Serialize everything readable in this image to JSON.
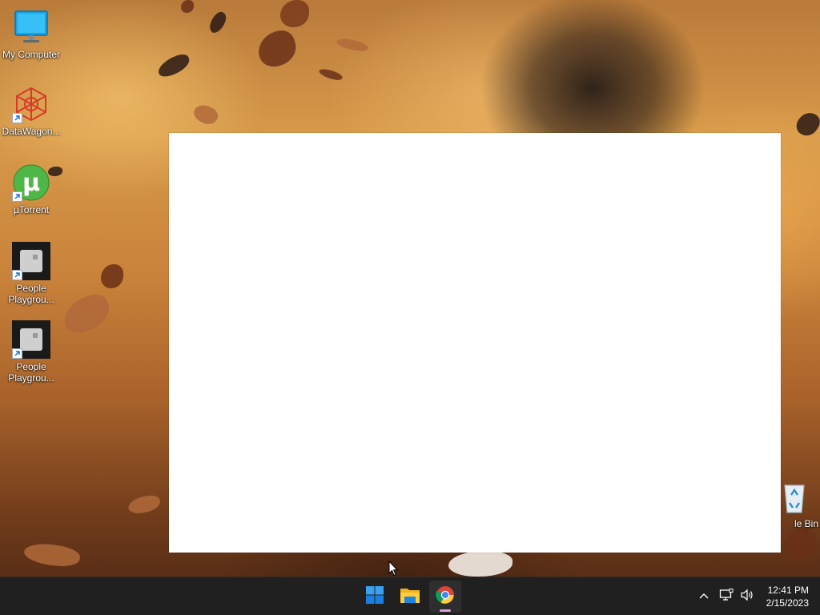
{
  "desktop": {
    "icons": [
      {
        "label": "My Computer",
        "icon": "monitor-icon"
      },
      {
        "label": "DataWagon...",
        "icon": "datawagon-icon"
      },
      {
        "label": "µTorrent",
        "icon": "utorrent-icon"
      },
      {
        "label": "People Playgrou...",
        "icon": "people-playground-icon"
      },
      {
        "label": "People Playgrou...",
        "icon": "people-playground-icon"
      },
      {
        "label": "le Bin",
        "icon": "recycle-bin-icon"
      }
    ]
  },
  "taskbar": {
    "apps": [
      {
        "name": "Start",
        "icon": "windows-start-icon"
      },
      {
        "name": "File Explorer",
        "icon": "folder-icon"
      },
      {
        "name": "Google Chrome",
        "icon": "chrome-icon",
        "active": true
      }
    ],
    "tray": {
      "icons": [
        "chevron-up-icon",
        "network-icon",
        "volume-icon"
      ]
    },
    "clock": {
      "time": "12:41 PM",
      "date": "2/15/2023"
    }
  },
  "colors": {
    "taskbar_bg": "#202020",
    "window_bg": "#ffffff",
    "accent_windows": "#1e90ff",
    "active_indicator": "#d8a0d8"
  }
}
